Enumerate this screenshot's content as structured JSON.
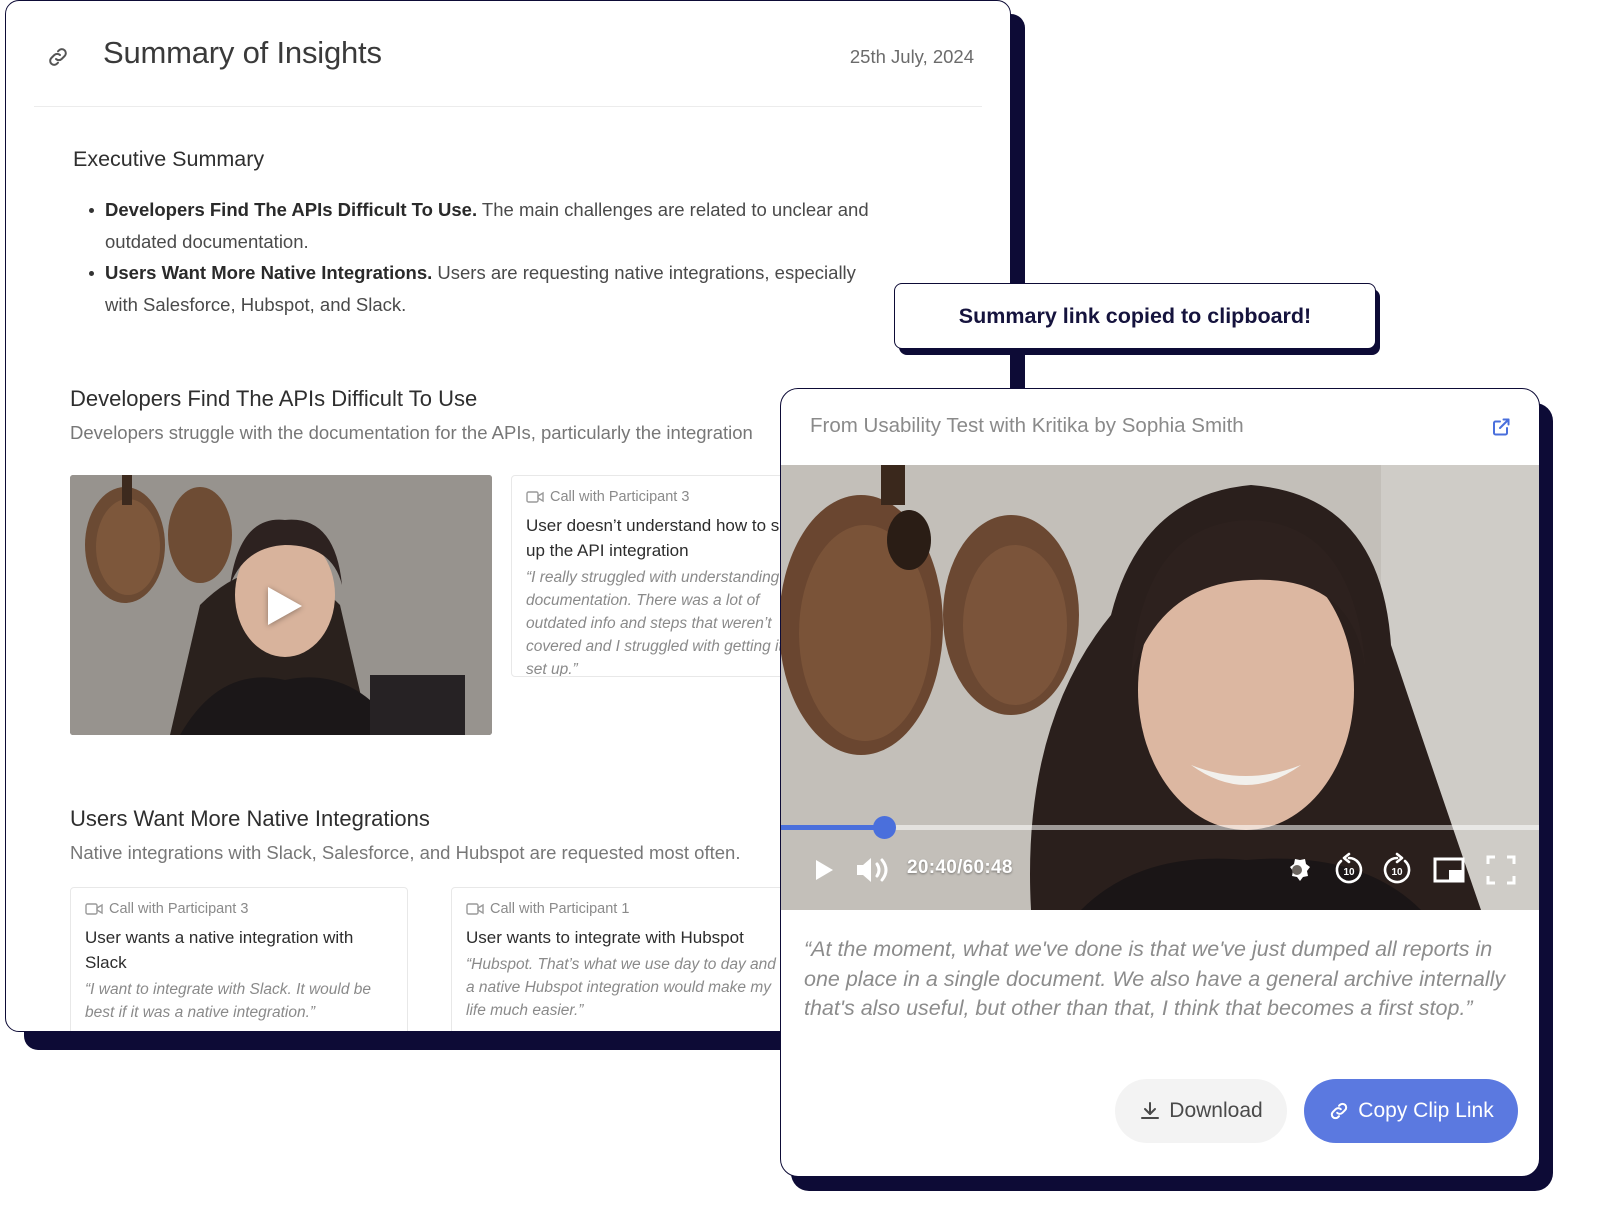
{
  "summary": {
    "title": "Summary of Insights",
    "date": "25th July, 2024",
    "executive": {
      "heading": "Executive Summary",
      "bullets": [
        {
          "bold": "Developers Find The APIs Difficult To Use.",
          "text": " The main challenges are related to unclear and outdated documentation."
        },
        {
          "bold": "Users Want More Native Integrations.",
          "text": " Users are requesting native integrations, especially with Salesforce, Hubspot, and Slack."
        }
      ]
    },
    "sections": [
      {
        "title": "Developers Find The APIs Difficult To Use",
        "subtitle": "Developers struggle with the documentation for the APIs, particularly the integration",
        "cards": [
          {
            "meta": "Call with Participant 3",
            "title": "User doesn’t understand how to set up the API integration",
            "quote": "“I really struggled with understanding the documentation. There was a lot of outdated info and steps that weren’t covered and I struggled with getting it set up.”"
          }
        ]
      },
      {
        "title": "Users Want More Native Integrations",
        "subtitle": "Native integrations with Slack, Salesforce, and Hubspot are requested most often.",
        "cards": [
          {
            "meta": "Call with Participant 3",
            "title": "User wants a native integration with Slack",
            "quote": "“I want to integrate with Slack. It would be best if it was a native integration.”"
          },
          {
            "meta": "Call with Participant 1",
            "title": "User wants to integrate with Hubspot",
            "quote": "“Hubspot. That’s what we use day to day and a native Hubspot integration would make my life much easier.”"
          }
        ]
      }
    ]
  },
  "toast": {
    "message": "Summary link copied to clipboard!"
  },
  "clip": {
    "source": "From Usability Test with Kritika by Sophia Smith",
    "time": "20:40/60:48",
    "progress": 0.135,
    "quote": "“At the moment, what we've done is that we've just dumped all reports in one place in a single document. We also have a general archive internally that's also useful, but other than that, I think that becomes a first stop.”",
    "download_label": "Download",
    "copy_label": "Copy Clip Link"
  },
  "colors": {
    "accent": "#5b79e0",
    "progress": "#4a6fdc",
    "outline": "#0d0b36"
  },
  "icons": [
    "link-icon",
    "camera-icon",
    "external-link-icon",
    "play-icon",
    "volume-icon",
    "settings-icon",
    "rewind-10-icon",
    "forward-10-icon",
    "picture-in-picture-icon",
    "fullscreen-icon",
    "download-icon"
  ]
}
